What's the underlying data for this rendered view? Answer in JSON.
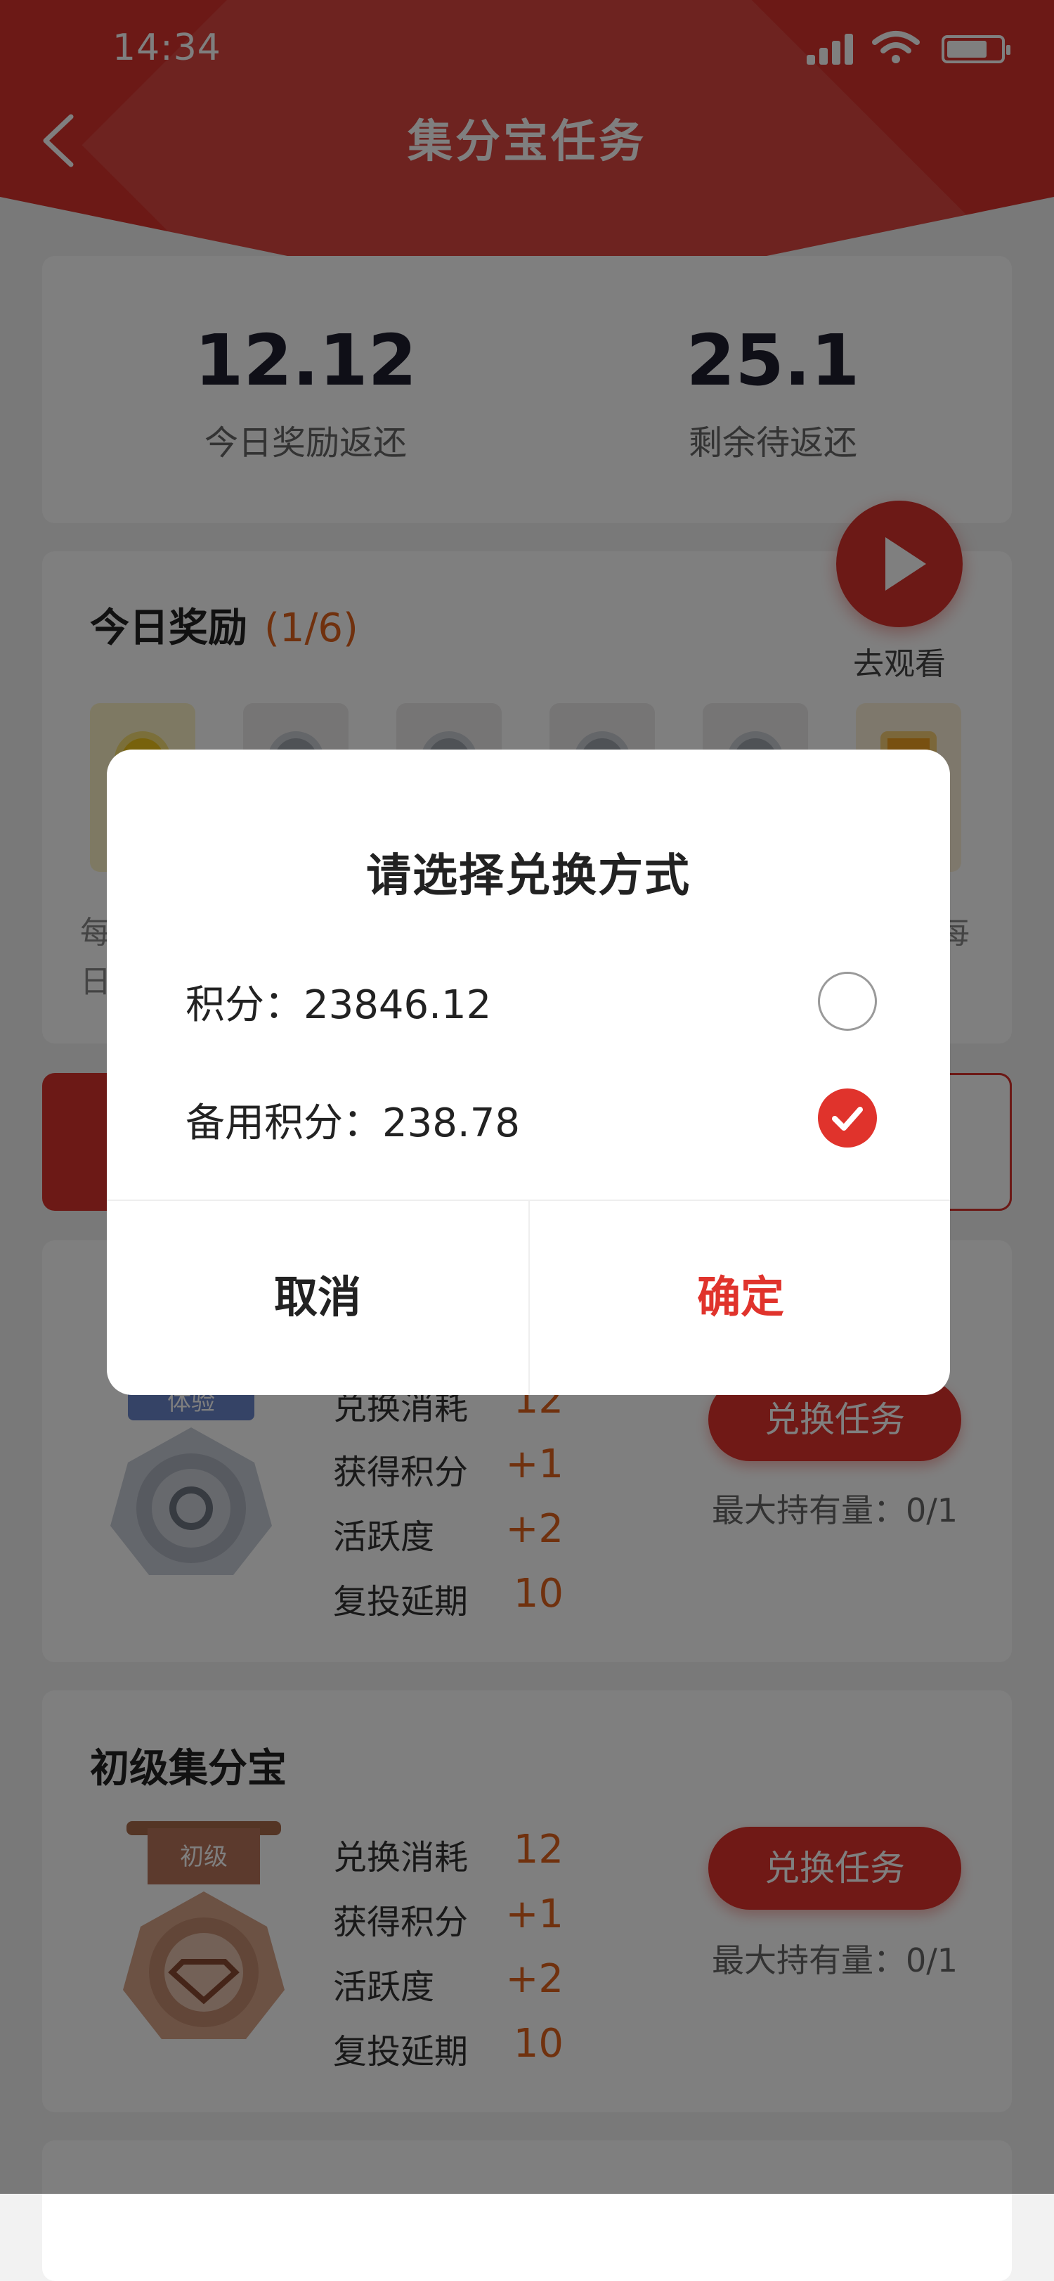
{
  "status_bar": {
    "time": "14:34"
  },
  "header": {
    "title": "集分宝任务"
  },
  "summary": {
    "today_value": "12.12",
    "today_label": "今日奖励返还",
    "remaining_value": "25.1",
    "remaining_label": "剩余待返还"
  },
  "today_rewards": {
    "title": "今日奖励",
    "progress": "(1/6)",
    "watch_label": "去观看",
    "edge_text_left_1": "每",
    "edge_text_left_2": "日",
    "edge_text_right": "每"
  },
  "tasks": [
    {
      "title": "",
      "medal_text": "体验",
      "rows": [
        {
          "label": "兑换消耗",
          "value": "12"
        },
        {
          "label": "获得积分",
          "value": "+1"
        },
        {
          "label": "活跃度",
          "value": "+2"
        },
        {
          "label": "复投延期",
          "value": "10"
        }
      ],
      "button": "兑换任务",
      "max_hold": "最大持有量：0/1"
    },
    {
      "title": "初级集分宝",
      "medal_text": "初级",
      "rows": [
        {
          "label": "兑换消耗",
          "value": "12"
        },
        {
          "label": "获得积分",
          "value": "+1"
        },
        {
          "label": "活跃度",
          "value": "+2"
        },
        {
          "label": "复投延期",
          "value": "10"
        }
      ],
      "button": "兑换任务",
      "max_hold": "最大持有量：0/1"
    }
  ],
  "dialog": {
    "title": "请选择兑换方式",
    "options": [
      {
        "label": "积分：23846.12",
        "selected": false
      },
      {
        "label": "备用积分：238.78",
        "selected": true
      }
    ],
    "cancel": "取消",
    "confirm": "确定"
  },
  "colors": {
    "brand_red": "#d8322c",
    "accent_orange": "#e0621c"
  }
}
